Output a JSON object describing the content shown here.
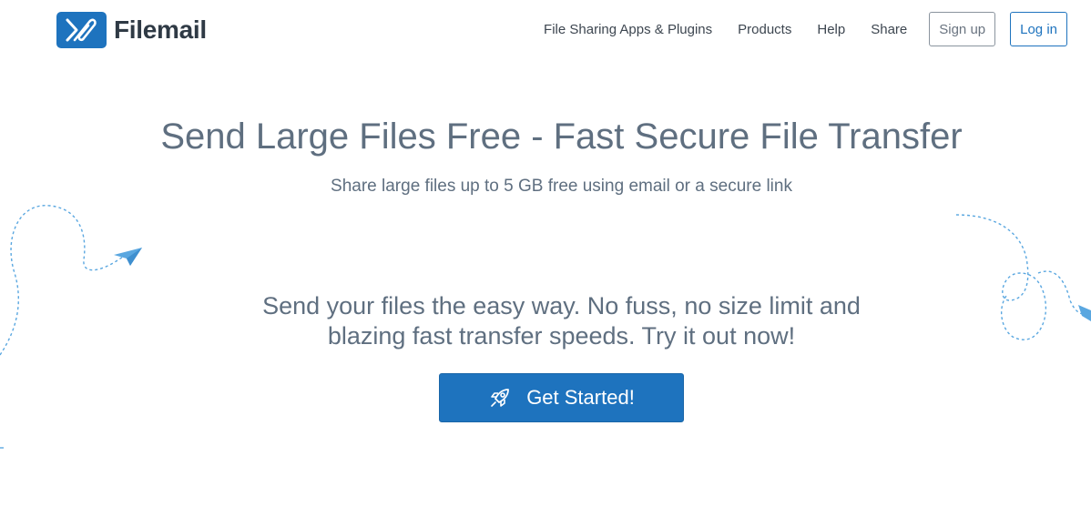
{
  "header": {
    "logo_text": "Filemail",
    "logo_icon": "filemail-logo-icon",
    "nav": [
      {
        "label": "File Sharing Apps & Plugins"
      },
      {
        "label": "Products"
      },
      {
        "label": "Help"
      },
      {
        "label": "Share"
      }
    ],
    "signup_label": "Sign up",
    "login_label": "Log in"
  },
  "hero": {
    "title": "Send Large Files Free - Fast Secure File Transfer",
    "subtitle": "Share large files up to 5 GB free using email or a secure link",
    "tagline_line1": "Send your files the easy way. No fuss, no size limit and",
    "tagline_line2": "blazing fast transfer speeds. Try it out now!",
    "cta_label": "Get Started!",
    "cta_icon": "rocket-icon"
  },
  "decorations": {
    "left": "paper-plane-icon",
    "right": "paper-plane-icon"
  },
  "colors": {
    "brand_blue": "#1e73be",
    "text_gray": "#5f6f80",
    "plane_blue": "#5aa7e0"
  }
}
